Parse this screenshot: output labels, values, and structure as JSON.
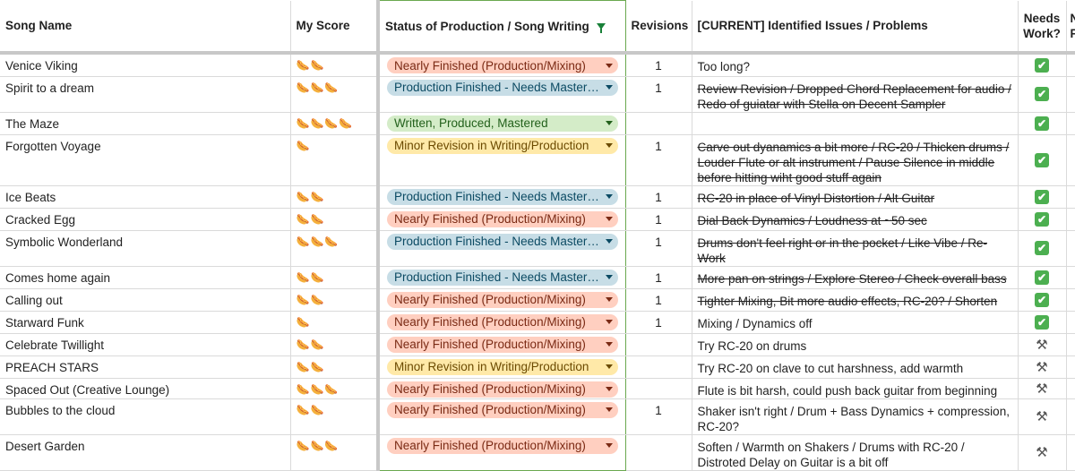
{
  "headers": {
    "song": "Song Name",
    "score": "My Score",
    "status": "Status of Production / Song Writing",
    "revisions": "Revisions",
    "issues": "[CURRENT] Identified Issues / Problems",
    "needs": "Needs Work?",
    "extra": "N P"
  },
  "colors": {
    "orange": "#ffcfc0",
    "blue": "#c7dde6",
    "green": "#d4ecc8",
    "yellow": "#ffe9a8",
    "check": "#4caf50",
    "filter": "#188038"
  },
  "rows": [
    {
      "song": "Venice Viking",
      "score": "🌭🌭",
      "status": "Nearly Finished (Production/Mixing)",
      "status_color": "orange",
      "revisions": "1",
      "issue": "Too long?",
      "issue_struck": false,
      "needs": "✔",
      "needs_type": "check"
    },
    {
      "song": "Spirit to a dream",
      "score": "🌭🌭🌭",
      "status": "Production Finished - Needs Mastering",
      "status_color": "blue",
      "revisions": "1",
      "issue": "Review Revision / Dropped Chord Replacement for audio / Redo of guiatar with Stella on Decent Sampler",
      "issue_struck": true,
      "needs": "✔",
      "needs_type": "check"
    },
    {
      "song": "The Maze",
      "score": "🌭🌭🌭🌭",
      "status": "Written, Produced, Mastered",
      "status_color": "green",
      "revisions": "",
      "issue": "",
      "issue_struck": false,
      "needs": "✔",
      "needs_type": "check"
    },
    {
      "song": "Forgotten Voyage",
      "score": "🌭",
      "status": "Minor Revision in Writing/Production",
      "status_color": "yellow",
      "revisions": "1",
      "issue": "Carve out dyanamics a bit more / RC-20 / Thicken drums / Louder Flute or alt instrument / Pause Silence in middle before hitting wiht good stuff again",
      "issue_struck": true,
      "needs": "✔",
      "needs_type": "check"
    },
    {
      "song": "Ice Beats",
      "score": "🌭🌭",
      "status": "Production Finished - Needs Mastering",
      "status_color": "blue",
      "revisions": "1",
      "issue": "RC-20 in place of Vinyl Distortion / Alt Guitar",
      "issue_struck": true,
      "needs": "✔",
      "needs_type": "check"
    },
    {
      "song": "Cracked Egg",
      "score": "🌭🌭",
      "status": "Nearly Finished (Production/Mixing)",
      "status_color": "orange",
      "revisions": "1",
      "issue": "Dial Back Dynamics / Loudness at ~50 sec",
      "issue_struck": true,
      "needs": "✔",
      "needs_type": "check"
    },
    {
      "song": "Symbolic Wonderland",
      "score": "🌭🌭🌭",
      "status": "Production Finished - Needs Mastering",
      "status_color": "blue",
      "revisions": "1",
      "issue": "Drums don't feel right or in the pocket / Like Vibe / Re-Work",
      "issue_struck": true,
      "needs": "✔",
      "needs_type": "check"
    },
    {
      "song": "Comes home again",
      "score": "🌭🌭",
      "status": "Production Finished - Needs Mastering",
      "status_color": "blue",
      "revisions": "1",
      "issue": "More pan on strings / Explore Stereo / Check overall bass",
      "issue_struck": true,
      "needs": "✔",
      "needs_type": "check"
    },
    {
      "song": "Calling out",
      "score": "🌭🌭",
      "status": "Nearly Finished (Production/Mixing)",
      "status_color": "orange",
      "revisions": "1",
      "issue": "Tighter Mixing, Bit more audio effects, RC-20? / Shorten",
      "issue_struck": true,
      "needs": "✔",
      "needs_type": "check"
    },
    {
      "song": "Starward Funk",
      "score": "🌭",
      "status": "Nearly Finished (Production/Mixing)",
      "status_color": "orange",
      "revisions": "1",
      "issue": "Mixing / Dynamics off",
      "issue_struck": false,
      "needs": "✔",
      "needs_type": "check"
    },
    {
      "song": "Celebrate Twillight",
      "score": "🌭🌭",
      "status": "Nearly Finished (Production/Mixing)",
      "status_color": "orange",
      "revisions": "",
      "issue": "Try RC-20 on drums",
      "issue_struck": false,
      "needs": "⚒",
      "needs_type": "tools"
    },
    {
      "song": "PREACH STARS",
      "score": "🌭🌭",
      "status": "Minor Revision in Writing/Production",
      "status_color": "yellow",
      "revisions": "",
      "issue": "Try RC-20 on clave to cut harshness, add warmth",
      "issue_struck": false,
      "needs": "⚒",
      "needs_type": "tools"
    },
    {
      "song": "Spaced Out (Creative Lounge)",
      "score": "🌭🌭🌭",
      "status": "Nearly Finished (Production/Mixing)",
      "status_color": "orange",
      "revisions": "",
      "issue": "Flute is bit harsh, could push back guitar from beginning",
      "issue_struck": false,
      "needs": "⚒",
      "needs_type": "tools"
    },
    {
      "song": "Bubbles to the cloud",
      "score": "🌭🌭",
      "status": "Nearly Finished (Production/Mixing)",
      "status_color": "orange",
      "revisions": "1",
      "issue": "Shaker isn't right / Drum + Bass Dynamics + compression, RC-20?",
      "issue_struck": false,
      "needs": "⚒",
      "needs_type": "tools"
    },
    {
      "song": "Desert Garden",
      "score": "🌭🌭🌭",
      "status": "Nearly Finished (Production/Mixing)",
      "status_color": "orange",
      "revisions": "",
      "issue": "Soften / Warmth on Shakers / Drums with RC-20 / Distroted Delay on Guitar is a bit off",
      "issue_struck": false,
      "needs": "⚒",
      "needs_type": "tools"
    }
  ]
}
